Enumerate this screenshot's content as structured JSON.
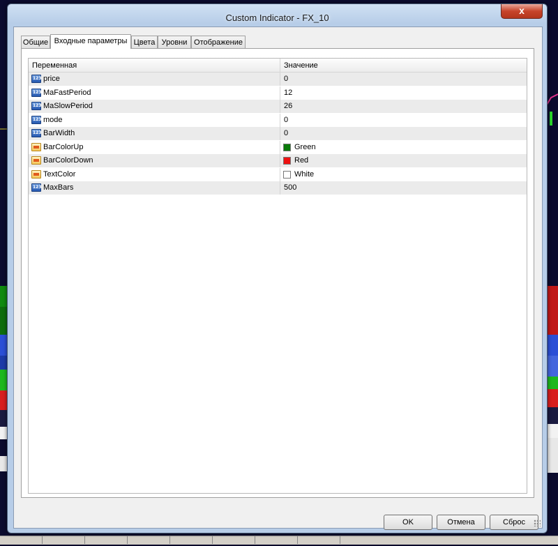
{
  "window": {
    "title": "Custom Indicator - FX_10",
    "close_label": "x"
  },
  "tabs": [
    {
      "label": "Общие",
      "active": false
    },
    {
      "label": "Входные параметры",
      "active": true
    },
    {
      "label": "Цвета",
      "active": false
    },
    {
      "label": "Уровни",
      "active": false
    },
    {
      "label": "Отображение",
      "active": false
    }
  ],
  "grid": {
    "columns": {
      "variable": "Переменная",
      "value": "Значение"
    },
    "rows": [
      {
        "name": "price",
        "type": "number",
        "value": "0"
      },
      {
        "name": "MaFastPeriod",
        "type": "number",
        "value": "12"
      },
      {
        "name": "MaSlowPeriod",
        "type": "number",
        "value": "26"
      },
      {
        "name": "mode",
        "type": "number",
        "value": "0"
      },
      {
        "name": "BarWidth",
        "type": "number",
        "value": "0"
      },
      {
        "name": "BarColorUp",
        "type": "color",
        "value": "Green",
        "swatch": "#0a7a0a"
      },
      {
        "name": "BarColorDown",
        "type": "color",
        "value": "Red",
        "swatch": "#ee1111"
      },
      {
        "name": "TextColor",
        "type": "color",
        "value": "White",
        "swatch": "#ffffff"
      },
      {
        "name": "MaxBars",
        "type": "number",
        "value": "500"
      }
    ]
  },
  "buttons": {
    "ok": "OK",
    "cancel": "Отмена",
    "reset": "Сброс"
  },
  "icons": {
    "number": "integer-param-icon",
    "color": "color-param-icon"
  }
}
